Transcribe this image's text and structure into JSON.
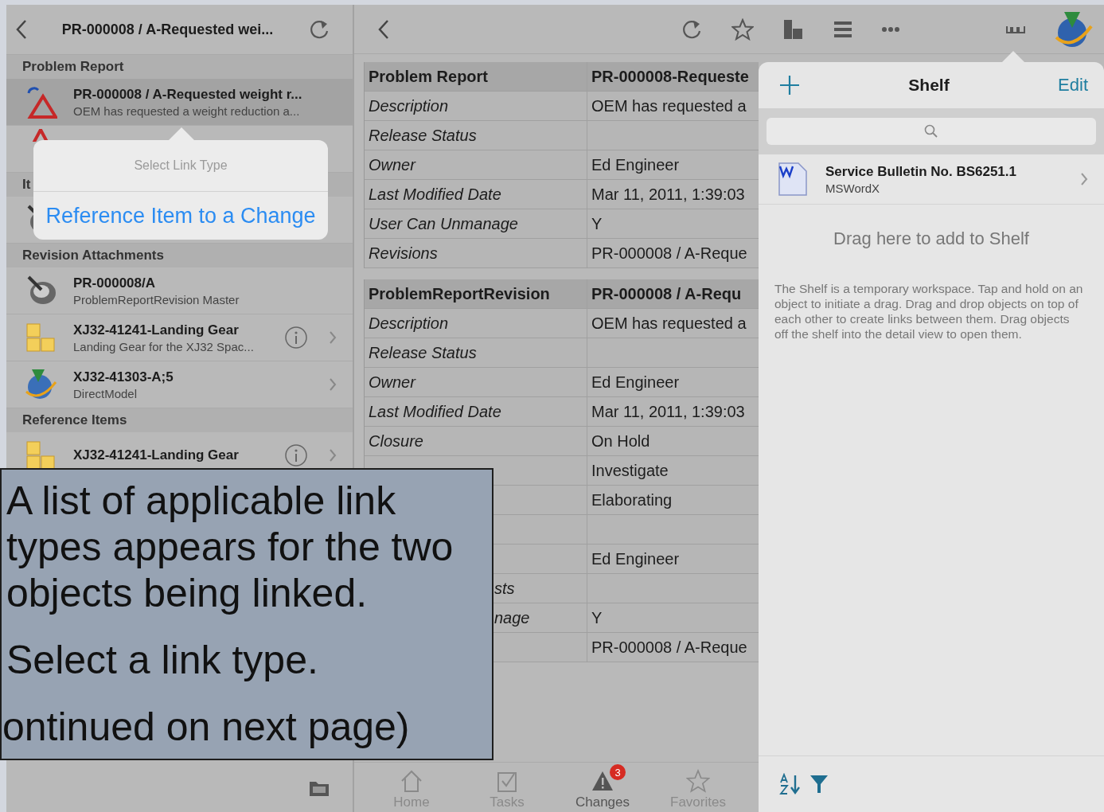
{
  "left_panel": {
    "title": "PR-000008 / A-Requested wei...",
    "sections": [
      {
        "header": "Problem Report",
        "rows": [
          {
            "kind": "change",
            "title": "PR-000008 / A-Requested weight r...",
            "subtitle": "OEM has requested a weight reduction a...",
            "selected": true,
            "info": false,
            "chevron": false
          },
          {
            "kind": "warning",
            "selected": false,
            "info": false,
            "chevron": false
          }
        ]
      },
      {
        "header": "It",
        "rows": [
          {
            "kind": "model",
            "selected": false,
            "info": false,
            "chevron": false
          }
        ]
      },
      {
        "header": "Revision Attachments",
        "rows": [
          {
            "kind": "model",
            "title": "PR-000008/A",
            "subtitle": "ProblemReportRevision Master",
            "selected": false,
            "info": false,
            "chevron": false
          },
          {
            "kind": "part",
            "title": "XJ32-41241-Landing Gear",
            "subtitle": "Landing Gear for the XJ32 Spac...",
            "selected": false,
            "info": true,
            "chevron": true
          },
          {
            "kind": "direct",
            "title": "XJ32-41303-A;5",
            "subtitle": "DirectModel",
            "selected": false,
            "info": false,
            "chevron": true
          }
        ]
      },
      {
        "header": "Reference Items",
        "rows": [
          {
            "kind": "part",
            "title": "XJ32-41241-Landing Gear",
            "selected": false,
            "info": true,
            "chevron": true
          }
        ]
      }
    ]
  },
  "link_type_popover": {
    "title": "Select Link Type",
    "options": [
      "Reference Item to a Change"
    ]
  },
  "detail_tables": [
    {
      "header": [
        "Problem Report",
        "PR-000008-Requeste"
      ],
      "rows": [
        {
          "kind": "full",
          "label": "Description",
          "value": "OEM has requested a"
        },
        {
          "kind": "full",
          "label": "Release Status"
        },
        {
          "kind": "full",
          "label": "Owner",
          "value": "Ed Engineer"
        },
        {
          "kind": "full",
          "label": "Last Modified Date",
          "value": "Mar 11, 2011, 1:39:03"
        },
        {
          "kind": "full",
          "label": "User Can Unmanage",
          "value": "Y"
        },
        {
          "kind": "full",
          "label": "Revisions",
          "value": "PR-000008 / A-Reque"
        }
      ]
    },
    {
      "header": [
        "ProblemReportRevision",
        "PR-000008 / A-Requ"
      ],
      "rows": [
        {
          "kind": "full",
          "label": "Description",
          "value": "OEM has requested a"
        },
        {
          "kind": "full",
          "label": "Release Status"
        },
        {
          "kind": "full",
          "label": "Owner",
          "value": "Ed Engineer"
        },
        {
          "kind": "full",
          "label": "Last Modified Date",
          "value": "Mar 11, 2011, 1:39:03"
        },
        {
          "kind": "full",
          "label": "Closure",
          "value": "On Hold"
        },
        {
          "kind": "cut",
          "value": "Investigate"
        },
        {
          "kind": "cut",
          "value": "Elaborating"
        },
        {
          "kind": "cut"
        },
        {
          "kind": "cut",
          "value": "Ed Engineer"
        },
        {
          "kind": "cut",
          "label": "sts"
        },
        {
          "kind": "cut",
          "label": "nage",
          "value": "Y"
        },
        {
          "kind": "cut",
          "value": "PR-000008 / A-Reque"
        }
      ]
    }
  ],
  "tab_bar": [
    {
      "label": "Home",
      "kind": "home",
      "selected": false
    },
    {
      "label": "Tasks",
      "kind": "tasks",
      "selected": false
    },
    {
      "label": "Changes",
      "kind": "changes",
      "selected": true,
      "badge": "3"
    },
    {
      "label": "Favorites",
      "kind": "favorites",
      "selected": false
    }
  ],
  "shelf": {
    "title": "Shelf",
    "edit": "Edit",
    "items": [
      {
        "title": "Service Bulletin No. BS6251.1",
        "subtitle": "MSWordX"
      }
    ],
    "drop_hint": "Drag here to add to Shelf",
    "help": "The Shelf is a temporary workspace. Tap and hold on an object to initiate a drag. Drag and drop objects on top of each other to create links between them. Drag objects off the shelf into the detail view to open them."
  },
  "caption": {
    "paragraphs": [
      "A list of applicable link types appears for the two objects being linked.",
      "Select a link type.",
      "ontinued on next page)"
    ]
  }
}
